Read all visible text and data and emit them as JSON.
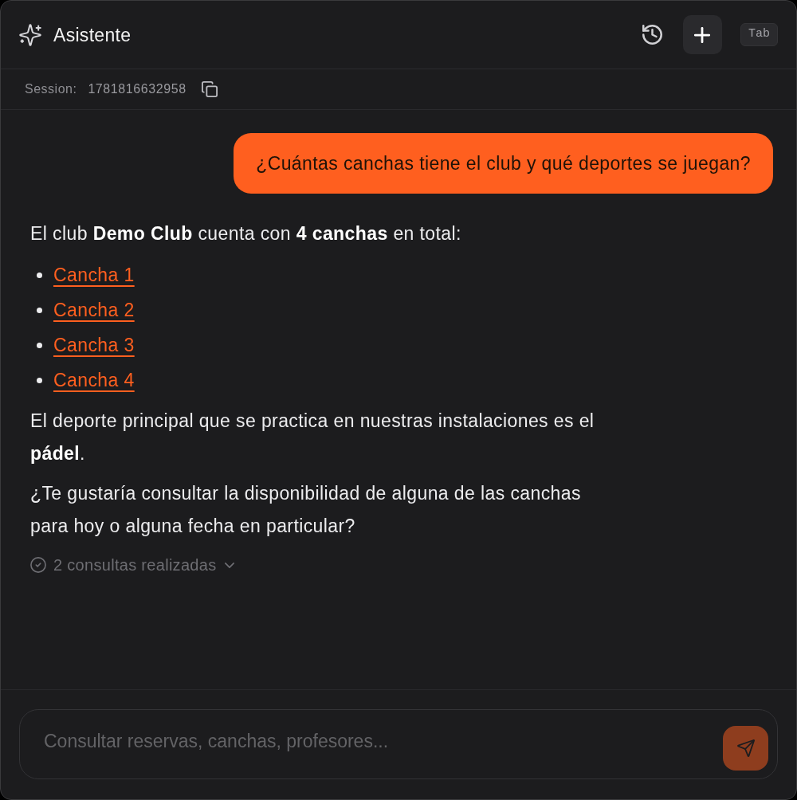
{
  "header": {
    "title": "Asistente",
    "shortcut": "Tab"
  },
  "session": {
    "label": "Session:",
    "id": "1781816632958"
  },
  "messages": [
    {
      "kind": "user",
      "text": "¿Cuántas canchas tiene el club y qué deportes se juegan?"
    },
    {
      "kind": "assistant",
      "blocks": [
        {
          "kind": "paragraph",
          "text": "El club **Demo Club** cuenta con **4 canchas** en total:"
        },
        {
          "kind": "list",
          "items": [
            "Cancha 1",
            "Cancha 2",
            "Cancha 3",
            "Cancha 4"
          ]
        },
        {
          "kind": "paragraph",
          "text": "El deporte principal que se practica en nuestras instalaciones es el **pádel**."
        },
        {
          "kind": "paragraph",
          "text": "¿Te gustaría consultar la disponibilidad de alguna de las canchas para hoy o alguna fecha en particular?"
        }
      ],
      "tool_summary": {
        "text": "2 consultas realizadas",
        "expanded": false
      }
    }
  ],
  "composer": {
    "placeholder": "Consultar reservas, canchas, profesores...",
    "send_disabled": true
  }
}
